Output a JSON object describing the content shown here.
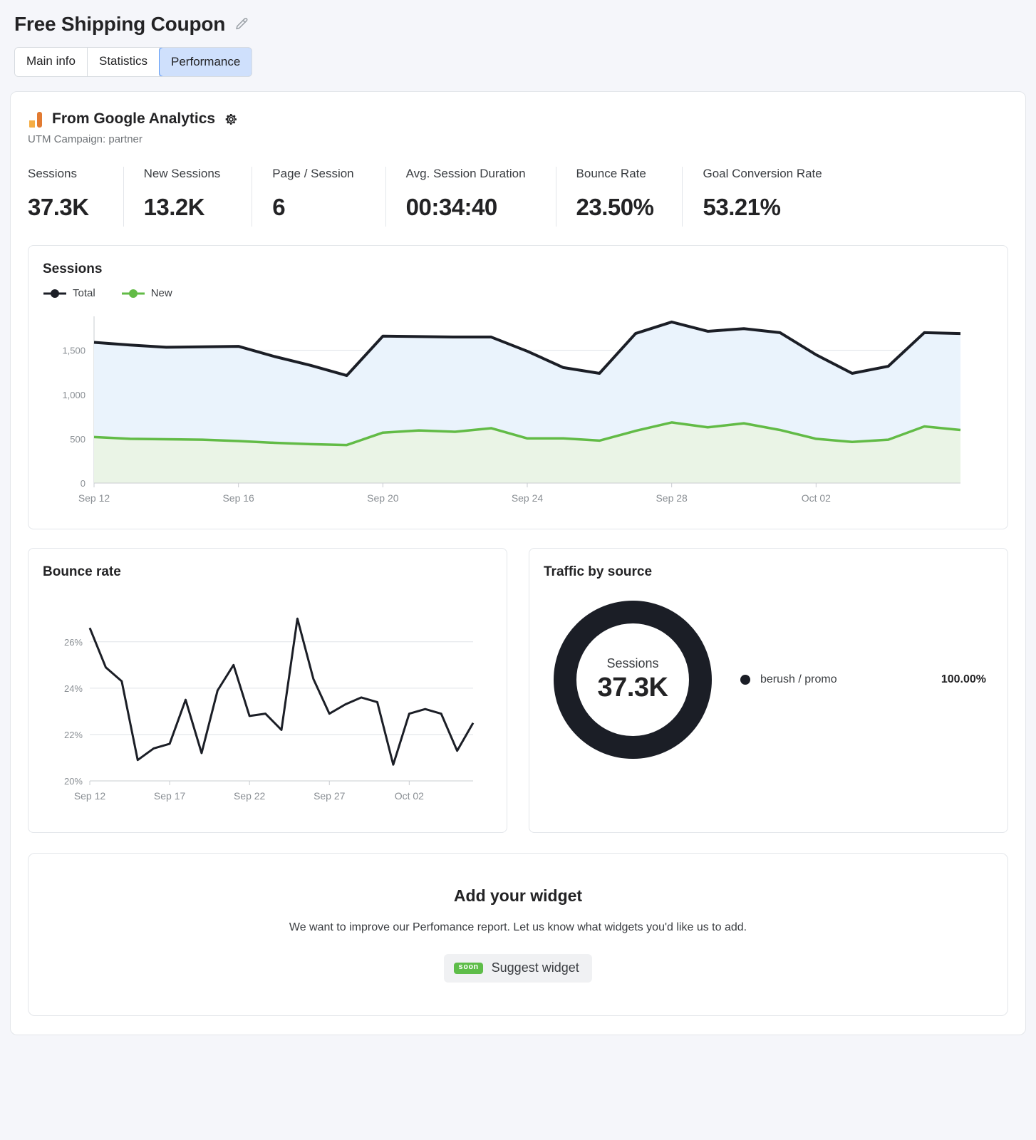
{
  "header": {
    "title": "Free Shipping Coupon",
    "edit_icon": "pencil-icon",
    "tabs": [
      {
        "label": "Main info",
        "active": false
      },
      {
        "label": "Statistics",
        "active": false
      },
      {
        "label": "Performance",
        "active": true
      }
    ]
  },
  "ga_panel": {
    "title": "From Google Analytics",
    "settings_icon": "gear-icon",
    "logo_icon": "google-analytics-icon",
    "subtitle": "UTM Campaign: partner",
    "metrics": [
      {
        "label": "Sessions",
        "value": "37.3K"
      },
      {
        "label": "New Sessions",
        "value": "13.2K"
      },
      {
        "label": "Page / Session",
        "value": "6"
      },
      {
        "label": "Avg. Session Duration",
        "value": "00:34:40"
      },
      {
        "label": "Bounce Rate",
        "value": "23.50%"
      },
      {
        "label": "Goal Conversion Rate",
        "value": "53.21%"
      }
    ]
  },
  "sessions_chart": {
    "title": "Sessions",
    "legend": [
      {
        "label": "Total",
        "color": "#1b1e26"
      },
      {
        "label": "New",
        "color": "#62bb46"
      }
    ]
  },
  "bounce_chart": {
    "title": "Bounce rate"
  },
  "traffic_by_source": {
    "title": "Traffic by source",
    "center_label": "Sessions",
    "center_value": "37.3K",
    "rows": [
      {
        "name": "berush / promo",
        "percent": "100.00%",
        "color": "#1b1e26"
      }
    ]
  },
  "add_widget": {
    "title": "Add your widget",
    "subtitle": "We want to improve our Perfomance report. Let us know what widgets you'd like us to add.",
    "button_label": "Suggest widget",
    "badge": "soon"
  },
  "colors": {
    "accent_blue": "#5d9bf8",
    "tab_active_bg": "#cfe0fc",
    "total_line": "#1b1e26",
    "new_line": "#62bb46",
    "total_fill": "#eaf3fc",
    "new_fill": "#eaf4e6",
    "ga_orange_light": "#f5ad45",
    "ga_orange_dark": "#e27b32",
    "badge_green": "#5ebd49"
  },
  "chart_data": [
    {
      "type": "area",
      "title": "Sessions",
      "xlabel": "",
      "ylabel": "",
      "ylim": [
        0,
        1900
      ],
      "yticks": [
        0,
        500,
        1000,
        1500
      ],
      "yticklabels": [
        "0",
        "500",
        "1,000",
        "1,500"
      ],
      "grid": true,
      "legend": [
        "Total",
        "New"
      ],
      "legend_position": "top-left",
      "x": [
        "Sep 12",
        "Sep 13",
        "Sep 14",
        "Sep 15",
        "Sep 16",
        "Sep 17",
        "Sep 18",
        "Sep 19",
        "Sep 20",
        "Sep 21",
        "Sep 22",
        "Sep 23",
        "Sep 24",
        "Sep 25",
        "Sep 26",
        "Sep 27",
        "Sep 28",
        "Sep 29",
        "Sep 30",
        "Oct 01",
        "Oct 02",
        "Oct 03",
        "Oct 04",
        "Oct 05"
      ],
      "xticklabels": [
        "Sep 12",
        "Sep 16",
        "Sep 20",
        "Sep 24",
        "Sep 28",
        "Oct 02"
      ],
      "series": [
        {
          "name": "Total",
          "color": "#1b1e26",
          "values": [
            1590,
            1560,
            1535,
            1540,
            1545,
            1430,
            1330,
            1215,
            1660,
            1655,
            1650,
            1650,
            1490,
            1305,
            1240,
            1690,
            1820,
            1715,
            1745,
            1700,
            1450,
            1240,
            1320,
            1700,
            1690
          ]
        },
        {
          "name": "New",
          "color": "#62bb46",
          "values": [
            520,
            500,
            495,
            490,
            475,
            455,
            440,
            430,
            570,
            595,
            580,
            620,
            505,
            505,
            480,
            590,
            685,
            630,
            675,
            600,
            500,
            465,
            490,
            640,
            600
          ]
        }
      ]
    },
    {
      "type": "line",
      "title": "Bounce rate",
      "ylim": [
        20,
        27.5
      ],
      "yticks": [
        20,
        22,
        24,
        26
      ],
      "yticklabels": [
        "20%",
        "22%",
        "24%",
        "26%"
      ],
      "grid": true,
      "xticklabels": [
        "Sep 12",
        "Sep 17",
        "Sep 22",
        "Sep 27",
        "Oct 02"
      ],
      "series": [
        {
          "name": "Bounce rate",
          "color": "#1b1e26",
          "values": [
            26.6,
            24.9,
            24.3,
            20.9,
            21.4,
            21.6,
            23.5,
            21.2,
            23.9,
            25.0,
            22.8,
            22.9,
            22.2,
            27.0,
            24.4,
            22.9,
            23.3,
            23.6,
            23.4,
            20.7,
            22.9,
            23.1,
            22.9,
            21.3,
            22.5
          ]
        }
      ]
    },
    {
      "type": "pie",
      "title": "Traffic by source",
      "labels": [
        "berush / promo"
      ],
      "values": [
        100.0
      ],
      "value_labels": [
        "100.00%"
      ],
      "colors": [
        "#1b1e26"
      ],
      "center_label": "Sessions",
      "center_value": "37.3K",
      "legend_position": "right"
    }
  ]
}
